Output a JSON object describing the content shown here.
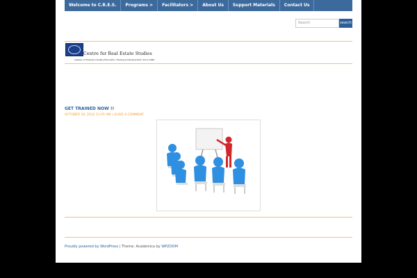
{
  "nav": {
    "items": [
      {
        "label": "Welcome to C.R.E.S."
      },
      {
        "label": "Programs >"
      },
      {
        "label": "Facilitators >"
      },
      {
        "label": "About Us"
      },
      {
        "label": "Support Materials"
      },
      {
        "label": "Contact Us"
      }
    ]
  },
  "search": {
    "placeholder": "Search",
    "button_label": "search"
  },
  "header": {
    "title": "Centre for Real Estate Studies",
    "tagline": "Leaders in Property Industry Education, Training & Development. Since 1996"
  },
  "post": {
    "title": "GET TRAINED NOW !!",
    "meta": "OCTOBER 16, 2012 11:05 AM | LEAVE A COMMENT"
  },
  "footer": {
    "powered_by": "Proudly powered by WordPress",
    "separator": " | Theme: Academica by ",
    "theme_author": "WPZOOM"
  },
  "colors": {
    "nav_bg": "#3d6a9c",
    "accent": "#2c5f9a",
    "meta": "#f29b30",
    "rule": "#e8c77b"
  }
}
